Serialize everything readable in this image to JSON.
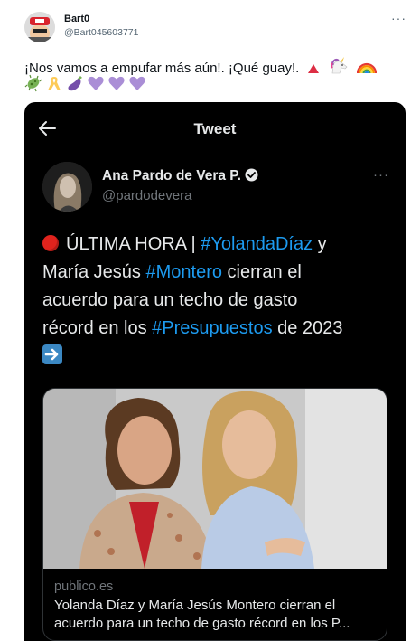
{
  "tweet": {
    "author_name": "Bart0",
    "author_handle": "@Bart045603771",
    "more_label": "···",
    "text_line1": "¡Nos vamos a empufar más aún!. ¡Qué guay!.",
    "emojis_line1": [
      "small-red-triangle",
      "unicorn",
      "rainbow"
    ],
    "emojis_line2": [
      "microbe",
      "yellow-ribbon",
      "eggplant",
      "purple-heart",
      "purple-heart",
      "purple-heart"
    ]
  },
  "screenshot": {
    "header_title": "Tweet",
    "back_icon": "arrow-left-icon",
    "inner_author_name": "Ana Pardo de Vera P.",
    "inner_author_handle": "@pardodevera",
    "inner_more_label": "···",
    "body": {
      "l1_prefix": "ÚLTIMA HORA | ",
      "l1_tag": "#YolandaDíaz",
      "l1_suffix": " y",
      "l2_prefix": "María Jesús ",
      "l2_tag": "#Montero",
      "l2_suffix": " cierran el",
      "l3": "acuerdo para un techo de gasto",
      "l4_prefix": "récord en los ",
      "l4_tag": "#Presupuestos",
      "l4_suffix": " de 2023"
    },
    "link_card": {
      "domain": "publico.es",
      "title_line1": "Yolanda Díaz y María Jesús Montero cierran el",
      "title_line2": "acuerdo para un techo de gasto récord en los P..."
    },
    "colors": {
      "background": "#000000",
      "hashtag": "#1d9bf0",
      "text": "#e7e9ea",
      "muted": "#71767b"
    }
  }
}
